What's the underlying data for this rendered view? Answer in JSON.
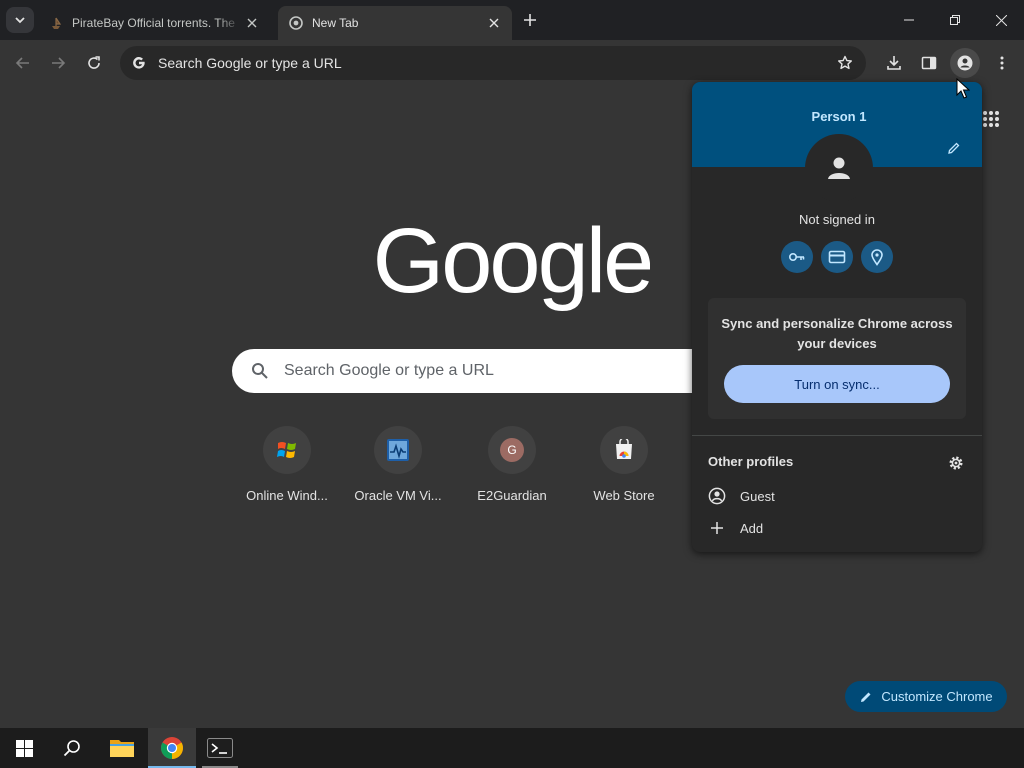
{
  "tabs": [
    {
      "title": "PirateBay Official torrents. The",
      "close_label": "✕"
    },
    {
      "title": "New Tab",
      "close_label": "✕"
    }
  ],
  "toolbar": {
    "omnibox_placeholder": "Search Google or type a URL"
  },
  "ntp": {
    "logo_text": "Google",
    "search_placeholder": "Search Google or type a URL",
    "shortcuts": [
      {
        "label": "Online Wind..."
      },
      {
        "label": "Oracle VM Vi..."
      },
      {
        "label": "E2Guardian",
        "letter": "G"
      },
      {
        "label": "Web Store"
      }
    ],
    "customize_label": "Customize Chrome"
  },
  "profile_menu": {
    "name": "Person 1",
    "status": "Not signed in",
    "sync_text": "Sync and personalize Chrome across your devices",
    "sync_button": "Turn on sync...",
    "other_profiles_label": "Other profiles",
    "rows": [
      {
        "label": "Guest"
      },
      {
        "label": "Add"
      }
    ]
  },
  "colors": {
    "accent": "#a8c7fa",
    "header": "#00507e",
    "customize_bg": "#004a77"
  }
}
